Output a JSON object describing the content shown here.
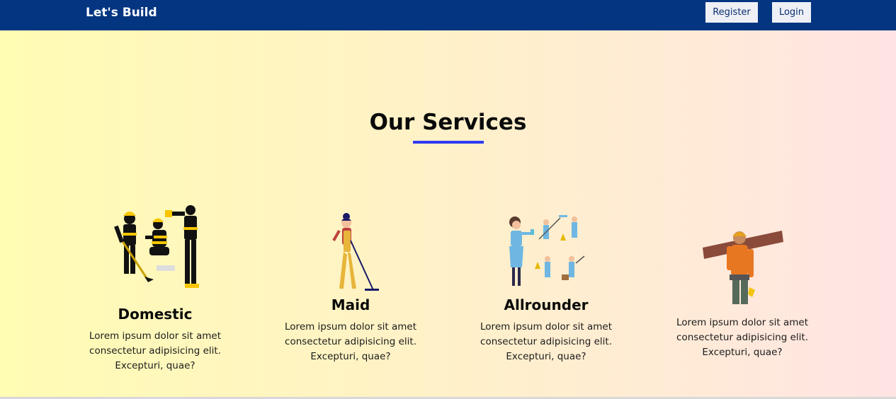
{
  "navbar": {
    "brand": "Let's Build",
    "register_label": "Register",
    "login_label": "Login"
  },
  "services": {
    "heading": "Our Services",
    "accent_color": "#2f3bf0",
    "items": [
      {
        "title": "Domestic",
        "icon": "construction-workers-illustration",
        "description": "Lorem ipsum dolor sit amet consectetur adipisicing elit. Excepturi, quae?"
      },
      {
        "title": "Maid",
        "icon": "maid-mopping-illustration",
        "description": "Lorem ipsum dolor sit amet consectetur adipisicing elit. Excepturi, quae?"
      },
      {
        "title": "Allrounder",
        "icon": "cleaning-staff-illustration",
        "description": "Lorem ipsum dolor sit amet consectetur adipisicing elit. Excepturi, quae?"
      },
      {
        "title": "",
        "icon": "carpenter-carrying-plank-illustration",
        "description": "Lorem ipsum dolor sit amet consectetur adipisicing elit. Excepturi, quae?"
      }
    ]
  },
  "colors": {
    "navbar": "#033581",
    "button_bg": "#eef0f6"
  }
}
